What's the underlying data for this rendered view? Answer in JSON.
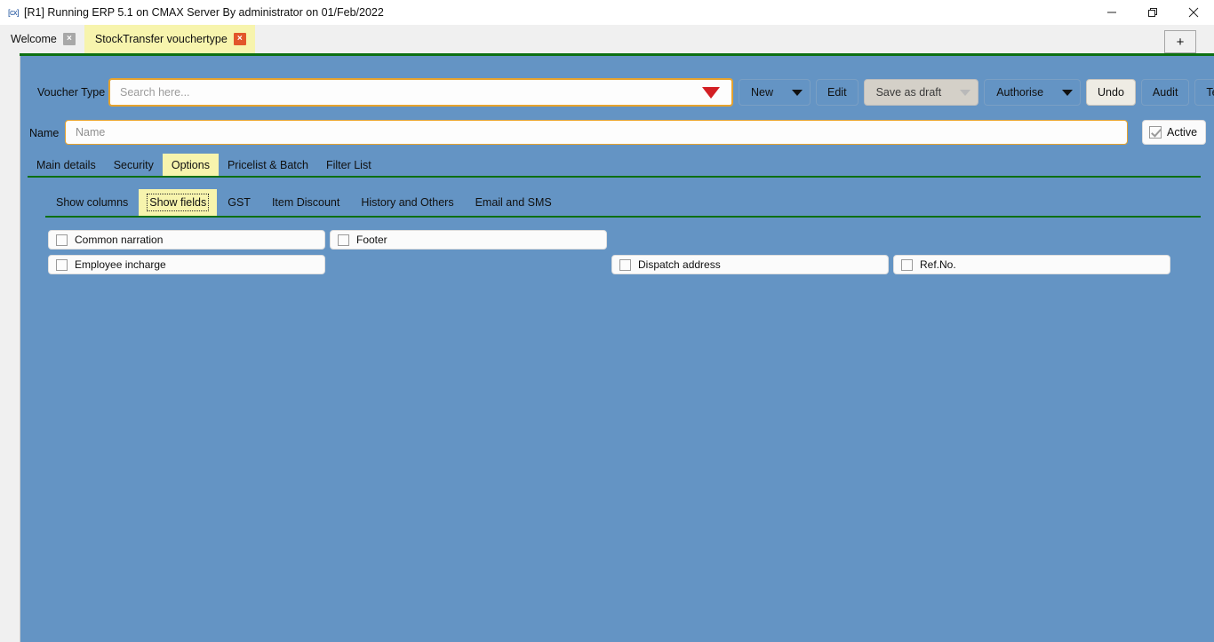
{
  "window": {
    "title": "[R1] Running ERP 5.1 on CMAX Server By administrator on 01/Feb/2022",
    "app_icon": "[cx]",
    "minimize_icon": "minimize-icon",
    "restore_icon": "restore-icon",
    "close_icon": "close-icon"
  },
  "tabstrip": {
    "tabs": [
      {
        "label": "Welcome",
        "close": "×",
        "active": false
      },
      {
        "label": "StockTransfer vouchertype",
        "close": "×",
        "active": true
      }
    ],
    "add_label": "+"
  },
  "form": {
    "voucher_type_label": "Voucher Type",
    "search_placeholder": "Search here...",
    "search_value": "",
    "name_label": "Name",
    "name_placeholder": "Name",
    "name_value": "",
    "active_label": "Active",
    "active_checked": true
  },
  "toolbar": {
    "new_label": "New",
    "edit_label": "Edit",
    "save_as_draft_label": "Save as draft",
    "authorise_label": "Authorise",
    "undo_label": "Undo",
    "audit_label": "Audit",
    "template_label": "Template"
  },
  "main_tabs": [
    {
      "label": "Main details",
      "active": false
    },
    {
      "label": "Security",
      "active": false
    },
    {
      "label": "Options",
      "active": true
    },
    {
      "label": "Pricelist & Batch",
      "active": false
    },
    {
      "label": "Filter List",
      "active": false
    }
  ],
  "sub_tabs": [
    {
      "label": "Show columns",
      "active": false
    },
    {
      "label": "Show fields",
      "active": true
    },
    {
      "label": "GST",
      "active": false
    },
    {
      "label": "Item Discount",
      "active": false
    },
    {
      "label": "History and Others",
      "active": false
    },
    {
      "label": "Email and SMS",
      "active": false
    }
  ],
  "fields": [
    {
      "label": "Common narration",
      "checked": false
    },
    {
      "label": "Footer",
      "checked": false
    },
    {
      "label": "Employee incharge",
      "checked": false
    },
    {
      "label": "Dispatch address",
      "checked": false
    },
    {
      "label": "Ref.No.",
      "checked": false
    }
  ],
  "colors": {
    "canvas_blue": "#6494c4",
    "separator_green": "#0d7012",
    "highlight_yellow": "#f7f4ad",
    "field_border_gold": "#e6a32e",
    "dropdown_red": "#d31f24",
    "close_orange": "#e2562a"
  }
}
